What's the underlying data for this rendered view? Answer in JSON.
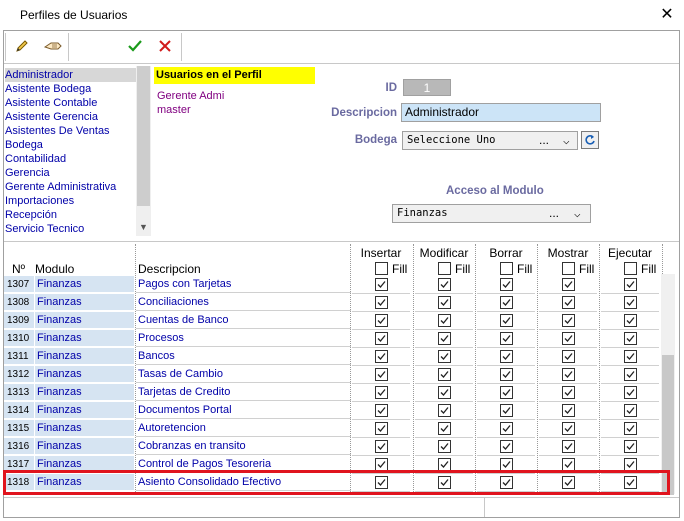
{
  "window": {
    "title": "Perfiles de Usuarios",
    "close": "✕"
  },
  "toolbar": {
    "edit_icon": "pencil-icon",
    "hand_icon": "hand-icon",
    "ok_icon": "check-icon",
    "cancel_icon": "x-icon"
  },
  "profiles": {
    "items": [
      "Administrador",
      "Asistente Bodega",
      "Asistente Contable",
      "Asistente Gerencia",
      "Asistentes De Ventas",
      "Bodega",
      "Contabilidad",
      "Gerencia",
      "Gerente Administrativa",
      "Importaciones",
      "Recepción",
      "Servicio Tecnico"
    ],
    "selected": "Administrador"
  },
  "users": {
    "header": "Usuarios en el Perfil",
    "items": [
      "Gerente Admi",
      "master"
    ]
  },
  "form": {
    "id_label": "ID",
    "id_value": "1",
    "desc_label": "Descripcion",
    "desc_value": "Administrador",
    "bodega_label": "Bodega",
    "bodega_value": "Seleccione Uno",
    "acceso_label": "Acceso al Modulo",
    "modulo_value": "Finanzas",
    "dots": "...",
    "chevron": "⌵"
  },
  "grid": {
    "col_num": "Nº",
    "col_mod": "Modulo",
    "col_desc": "Descripcion",
    "perm_cols": [
      "Insertar",
      "Modificar",
      "Borrar",
      "Mostrar",
      "Ejecutar"
    ],
    "fill_label": "Fill",
    "rows": [
      {
        "num": "1307",
        "mod": "Finanzas",
        "desc": "Pagos con Tarjetas"
      },
      {
        "num": "1308",
        "mod": "Finanzas",
        "desc": "Conciliaciones"
      },
      {
        "num": "1309",
        "mod": "Finanzas",
        "desc": "Cuentas de Banco"
      },
      {
        "num": "1310",
        "mod": "Finanzas",
        "desc": "Procesos"
      },
      {
        "num": "1311",
        "mod": "Finanzas",
        "desc": "Bancos"
      },
      {
        "num": "1312",
        "mod": "Finanzas",
        "desc": "Tasas de Cambio"
      },
      {
        "num": "1313",
        "mod": "Finanzas",
        "desc": "Tarjetas de Credito"
      },
      {
        "num": "1314",
        "mod": "Finanzas",
        "desc": "Documentos Portal"
      },
      {
        "num": "1315",
        "mod": "Finanzas",
        "desc": "Autoretencion"
      },
      {
        "num": "1316",
        "mod": "Finanzas",
        "desc": "Cobranzas en transito"
      },
      {
        "num": "1317",
        "mod": "Finanzas",
        "desc": "Control de Pagos Tesoreria"
      },
      {
        "num": "1318",
        "mod": "Finanzas",
        "desc": "Asiento Consolidado Efectivo"
      }
    ]
  },
  "colors": {
    "highlight": "#e0141e",
    "header_yellow": "#ffff00",
    "link_blue": "#0000a8",
    "desc_bg": "#cce4f7"
  }
}
